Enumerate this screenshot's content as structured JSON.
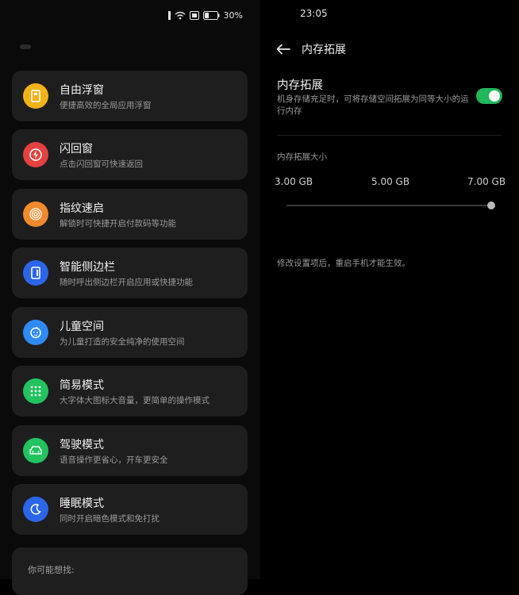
{
  "colors": {
    "toggle_on": "#21b65a",
    "floating_window": "#f2b21a",
    "flashback": "#e44141",
    "quick_launch": "#f08a2b",
    "smart_sidebar": "#2b66e8",
    "kids_space": "#2e8af5",
    "simple_mode": "#22c35e",
    "driving_mode": "#22c35e",
    "sleep_mode": "#2b66e8"
  },
  "status_bar": {
    "battery": "30%",
    "time": "23:05"
  },
  "left_panel": {
    "items": [
      {
        "title": "自由浮窗",
        "subtitle": "便捷高效的全局应用浮窗",
        "icon": "floating-window-icon"
      },
      {
        "title": "闪回窗",
        "subtitle": "点击闪回窗可快速返回",
        "icon": "lightning-icon"
      },
      {
        "title": "指纹速启",
        "subtitle": "解锁时可快捷开启付款码等功能",
        "icon": "fingerprint-icon"
      },
      {
        "title": "智能侧边栏",
        "subtitle": "随时呼出侧边栏开启应用或快捷功能",
        "icon": "sidebar-icon"
      },
      {
        "title": "儿童空间",
        "subtitle": "为儿童打造的安全纯净的使用空间",
        "icon": "child-face-icon"
      },
      {
        "title": "简易模式",
        "subtitle": "大字体大图标大音量，更简单的操作模式",
        "icon": "grid-dots-icon"
      },
      {
        "title": "驾驶模式",
        "subtitle": "语音操作更省心，开车更安全",
        "icon": "car-icon"
      },
      {
        "title": "睡眠模式",
        "subtitle": "同时开启暗色模式和免打扰",
        "icon": "moon-icon"
      }
    ],
    "suggest_label": "你可能想找:"
  },
  "right_panel": {
    "nav_title": "内存拓展",
    "setting": {
      "title": "内存拓展",
      "description": "机身存储充足时，可将存储空间拓展为同等大小的运行内存",
      "enabled": true
    },
    "size_section": {
      "label": "内存拓展大小",
      "options": [
        "3.00 GB",
        "5.00 GB",
        "7.00 GB"
      ],
      "selected": "7.00 GB"
    },
    "note": "修改设置项后，重启手机才能生效。"
  }
}
